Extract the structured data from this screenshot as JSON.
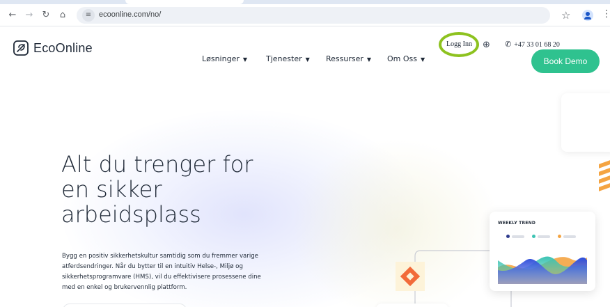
{
  "browser": {
    "url": "ecoonline.com/no/",
    "back_icon": "arrow-left-icon",
    "forward_icon": "arrow-right-icon",
    "reload_icon": "reload-icon",
    "home_icon": "home-icon",
    "bookmark_icon": "star-icon",
    "menu_icon": "kebab-menu-icon"
  },
  "site": {
    "logo_text": "EcoOnline",
    "nav": [
      "Løsninger",
      "Tjenester",
      "Ressurser",
      "Om Oss"
    ],
    "login": "Logg Inn",
    "phone": "+47 33 01 68 20",
    "cta": "Book Demo",
    "hero": {
      "title_lines": [
        "Alt du trenger for",
        "en sikker",
        "arbeidsplass"
      ],
      "text_lines": [
        "Bygg en positiv sikkerhetskultur samtidig som du fremmer varige",
        "atferdsendringer. Når du bytter til en intuitiv Helse-, Miljø og",
        "sikkerhetsprogramvare (HMS), vil du effektivisere prosessene dine",
        "med en enkel og brukervennlig plattform."
      ]
    },
    "trend_card": {
      "title": "WEEKLY TREND",
      "legend_colors": [
        "#2d3a8c",
        "#3cc3b3",
        "#f4a442"
      ]
    },
    "colors": {
      "accent": "#2fc28f",
      "highlight_ring": "#8dc21f",
      "text": "#1f2937"
    }
  }
}
